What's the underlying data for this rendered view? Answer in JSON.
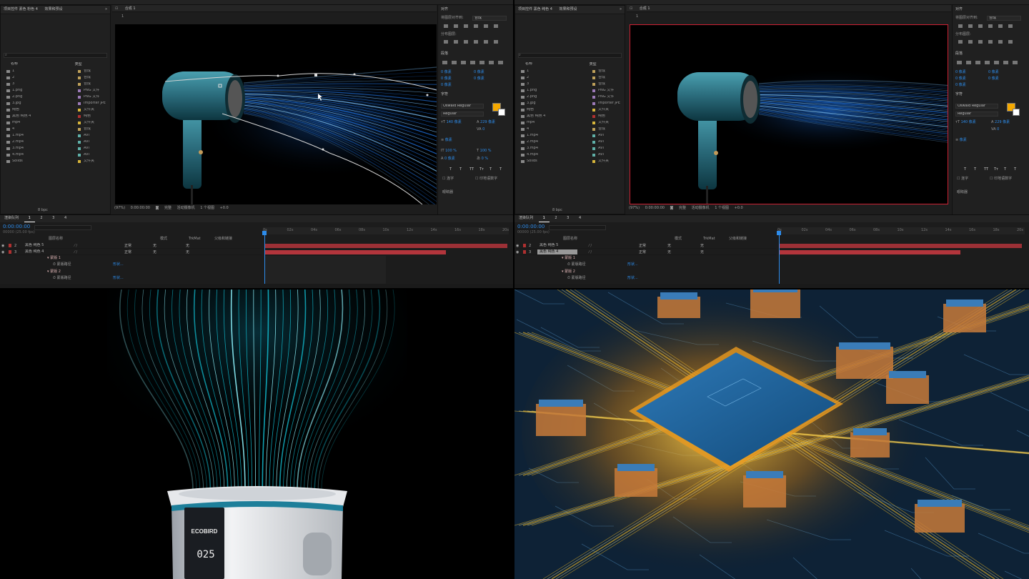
{
  "left_app": {
    "project_header": "项目控件 素色 粉色 4",
    "effects_header": "效果和预设",
    "expand": "»",
    "comp_tab": "合成 1",
    "comp_breadcrumb": "1",
    "col_name": "名称",
    "col_type": "类型",
    "items": [
      {
        "name": "1",
        "type": "合成",
        "color": "#bfa15a"
      },
      {
        "name": "2",
        "type": "合成",
        "color": "#bfa15a"
      },
      {
        "name": "3",
        "type": "合成",
        "color": "#bfa15a"
      },
      {
        "name": "1.png",
        "type": "PNG 文件",
        "color": "#9c7ab8"
      },
      {
        "name": "2.png",
        "type": "PNG 文件",
        "color": "#9c7ab8"
      },
      {
        "name": "3.jpg",
        "type": "Importer JPE",
        "color": "#9c7ab8"
      },
      {
        "name": "纯色",
        "type": "文件夹",
        "color": "#d7b53a"
      },
      {
        "name": "黑色 纯色 4",
        "type": "纯色",
        "color": "#b03030"
      },
      {
        "name": "mp4",
        "type": "文件夹",
        "color": "#d7b53a"
      },
      {
        "name": "4",
        "type": "合成",
        "color": "#bfa15a"
      },
      {
        "name": "1.mp4",
        "type": "AVI",
        "color": "#5fb0a8"
      },
      {
        "name": "2.mp4",
        "type": "AVI",
        "color": "#5fb0a8"
      },
      {
        "name": "3.mp4",
        "type": "AVI",
        "color": "#5fb0a8"
      },
      {
        "name": "4.mp4",
        "type": "AVI",
        "color": "#5fb0a8"
      },
      {
        "name": "Solids",
        "type": "文件夹",
        "color": "#d7b53a"
      }
    ],
    "bpc": "8 bpc",
    "viewer_bar": [
      "(97%)",
      "0:00:00:00",
      "完整",
      "活动摄像机",
      "1 个视图",
      "+0.0"
    ],
    "align_header": "对齐",
    "align_to_label": "将图层对齐到:",
    "align_to_value": "合成",
    "distribute_label": "分布图层:",
    "para_header": "段落",
    "char_header": "字符",
    "font": "Oswald Regular",
    "font_style": "Regular",
    "font_size": "140 像素",
    "leading": "229 像素",
    "tracking": "0",
    "stroke_w": "像素",
    "scale_v": "100 %",
    "scale_h": "100 %",
    "baseline": "0 像素",
    "tsume": "0 %",
    "para_vals": [
      "0 像素",
      "0 像素",
      "0 像素",
      "0 像素",
      "0 像素"
    ],
    "text_style_btns": [
      "T",
      "T",
      "TT",
      "Tт",
      "T",
      "T"
    ],
    "ligature": "连字",
    "hindi_digits": "印地语数字",
    "footer_link": "眼睛器",
    "timeline_tabs": [
      "渲染队列",
      "1",
      "2",
      "3",
      "4"
    ],
    "timecode": "0:00:00:00",
    "frames": "00000 (25.00 fps)",
    "col_layer_name": "图层名称",
    "col_mode": "模式",
    "col_trkmat": "TrkMat",
    "col_parent": "父级和链接",
    "layers": [
      {
        "num": "2",
        "name": "黑色 纯色 5",
        "mode": "正常",
        "trk": "无",
        "parent": "无"
      },
      {
        "num": "3",
        "name": "黑色 纯色 4",
        "mode": "正常",
        "trk": "无",
        "parent": "无"
      }
    ],
    "sublayers": [
      {
        "name": "蒙版 1",
        "path": "蒙版路径",
        "link": "形状..."
      },
      {
        "name": "蒙版 2",
        "path": "蒙版路径",
        "link": "形状..."
      }
    ],
    "ruler_ticks": [
      "0s",
      "02s",
      "04s",
      "06s",
      "08s",
      "10s",
      "12s",
      "14s",
      "16s",
      "18s",
      "20s"
    ]
  },
  "right_app": {
    "project_header": "项目控件 黑色 纯色 4",
    "effects_header": "效果和预设"
  },
  "bottom_left": {
    "product_brand": "ECOBIRD",
    "display_value": "025"
  },
  "colors": {
    "accent_blue": "#2d8ceb",
    "layer_red": "#9c3036",
    "chip_gold": "#ffc72a",
    "hair_teal": "#2a6a7a"
  }
}
